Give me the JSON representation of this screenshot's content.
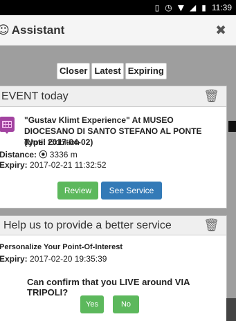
{
  "status_bar": {
    "time": "11:39",
    "icons": [
      "vibrate-icon",
      "alarm-icon",
      "wifi-icon",
      "signal-icon",
      "battery-icon"
    ]
  },
  "header": {
    "icon": "smiley-icon",
    "title": "Assistant",
    "close_icon": "close-icon"
  },
  "filters": [
    "Closer",
    "Latest",
    "Expiring"
  ],
  "event_card": {
    "header": "EVENT today",
    "title": "\"Gustav Klimt Experience\" At MUSEO DIOCESANO DI SANTO STEFANO AL PONTE (Until 2017-04-02)",
    "type_label": "Type:",
    "type_value": "Exibition",
    "distance_label": "Distance:",
    "distance_value": "3336 m",
    "expiry_label": "Expiry:",
    "expiry_value": "2017-02-21 11:32:52",
    "review_button": "Review",
    "service_button": "See Service"
  },
  "survey_card": {
    "header": "Help us to provide a better service",
    "title": "Personalize Your Point-Of-Interest",
    "expiry_label": "Expiry:",
    "expiry_value": "2017-02-20 19:35:39",
    "question": "Can confirm that you LIVE around VIA TRIPOLI?",
    "yes_button": "Yes",
    "no_button": "No"
  },
  "colors": {
    "primary_green": "#5cb85c",
    "primary_blue": "#337ab7",
    "poi_purple": "#a243a0",
    "backdrop_gray": "#9e9e9e"
  }
}
